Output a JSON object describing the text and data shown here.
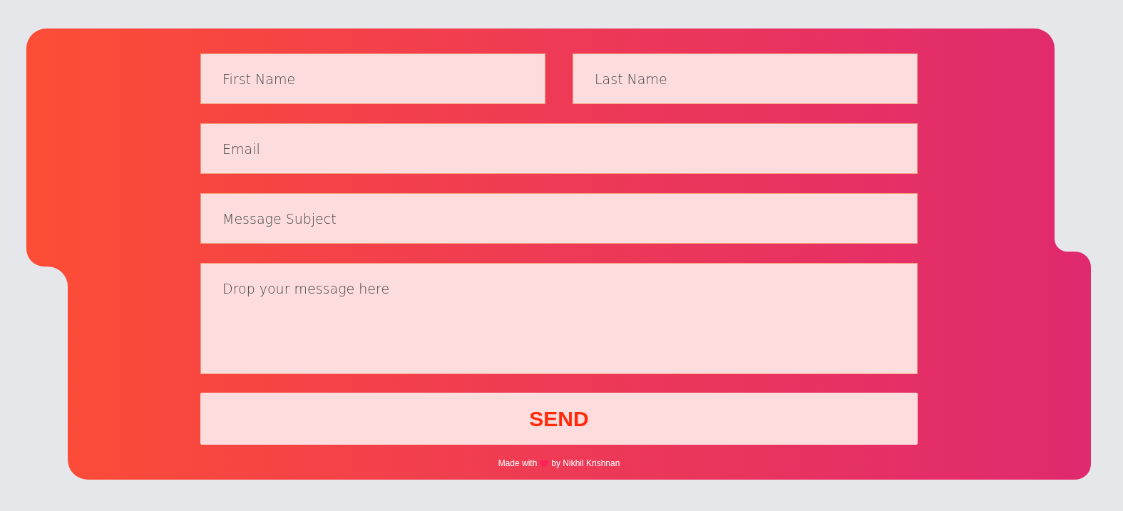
{
  "form": {
    "fields": [
      {
        "kind": "input",
        "placeholder": "First Name"
      },
      {
        "kind": "input",
        "placeholder": "Last Name"
      },
      {
        "kind": "input",
        "placeholder": "Email"
      },
      {
        "kind": "input",
        "placeholder": "Message Subject"
      },
      {
        "kind": "textarea",
        "placeholder": "Drop your message here"
      }
    ],
    "submit": "SEND"
  },
  "footer": {
    "before": "Made with",
    "after": "by Nikhil Krishnan"
  }
}
